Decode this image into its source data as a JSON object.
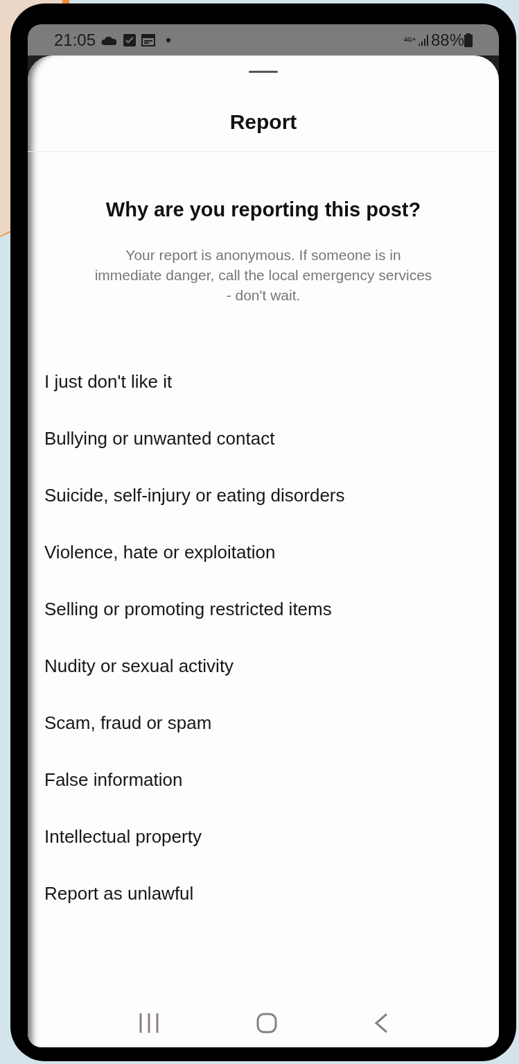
{
  "status_bar": {
    "time": "21:05",
    "network": "4G+",
    "battery": "88%"
  },
  "sheet": {
    "title": "Report",
    "heading": "Why are you reporting this post?",
    "description": "Your report is anonymous. If someone is in immediate danger, call the local emergency services - don't wait.",
    "options": [
      {
        "label": "I just don't like it"
      },
      {
        "label": "Bullying or unwanted contact"
      },
      {
        "label": "Suicide, self-injury or eating disorders"
      },
      {
        "label": "Violence, hate or exploitation"
      },
      {
        "label": "Selling or promoting restricted items"
      },
      {
        "label": "Nudity or sexual activity"
      },
      {
        "label": "Scam, fraud or spam"
      },
      {
        "label": "False information"
      },
      {
        "label": "Intellectual property"
      },
      {
        "label": "Report as unlawful"
      }
    ]
  }
}
